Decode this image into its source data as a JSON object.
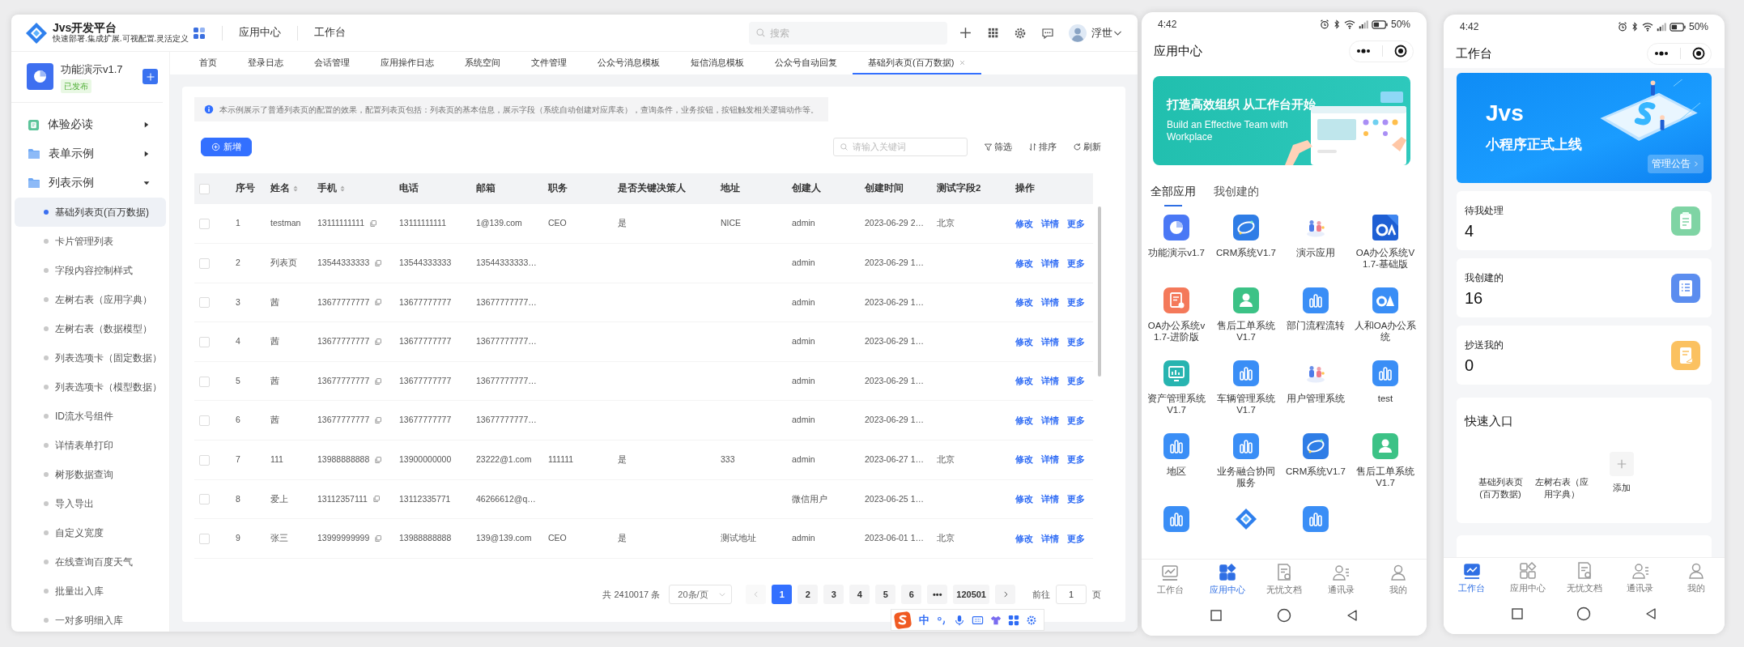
{
  "desktop": {
    "brand": {
      "name": "Jvs开发平台",
      "tagline": "快速部署.集成扩展.可视配置.灵活定义"
    },
    "top_nav": [
      {
        "label": "应用中心"
      },
      {
        "label": "工作台"
      }
    ],
    "search": {
      "placeholder": "搜索"
    },
    "user": {
      "name": "浮世"
    },
    "app": {
      "name": "功能演示v1.7",
      "status": "已发布"
    },
    "menu": [
      {
        "label": "体验必读",
        "kind": "guide",
        "expanded": false
      },
      {
        "label": "表单示例",
        "kind": "folder",
        "expanded": false
      },
      {
        "label": "列表示例",
        "kind": "folder",
        "expanded": true,
        "children": [
          {
            "label": "基础列表页(百万数据)",
            "selected": true
          },
          {
            "label": "卡片管理列表",
            "selected": false
          },
          {
            "label": "字段内容控制样式",
            "selected": false
          },
          {
            "label": "左树右表（应用字典）",
            "selected": false
          },
          {
            "label": "左树右表（数据模型）",
            "selected": false
          },
          {
            "label": "列表选项卡（固定数据）",
            "selected": false
          },
          {
            "label": "列表选项卡（模型数据）",
            "selected": false
          },
          {
            "label": "ID流水号组件",
            "selected": false
          },
          {
            "label": "详情表单打印",
            "selected": false
          },
          {
            "label": "树形数据查询",
            "selected": false
          },
          {
            "label": "导入导出",
            "selected": false
          },
          {
            "label": "自定义宽度",
            "selected": false
          },
          {
            "label": "在线查询百度天气",
            "selected": false
          },
          {
            "label": "批量出入库",
            "selected": false
          },
          {
            "label": "一对多明细入库",
            "selected": false
          }
        ]
      }
    ],
    "tabs": [
      {
        "label": "首页",
        "selected": false
      },
      {
        "label": "登录日志",
        "selected": false
      },
      {
        "label": "会话管理",
        "selected": false
      },
      {
        "label": "应用操作日志",
        "selected": false
      },
      {
        "label": "系统空间",
        "selected": false
      },
      {
        "label": "文件管理",
        "selected": false
      },
      {
        "label": "公众号消息模板",
        "selected": false
      },
      {
        "label": "短信消息模板",
        "selected": false
      },
      {
        "label": "公众号自动回复",
        "selected": false
      },
      {
        "label": "基础列表页(百万数据)",
        "selected": true
      }
    ],
    "notice": "本示例展示了普通列表页的配置的效果，配置列表页包括：列表页的基本信息，展示字段（系统自动创建对应库表），查询条件，业务按钮，按钮触发相关逻辑动作等。",
    "add_button": "新增",
    "keyword_search": {
      "placeholder": "请输入关键词"
    },
    "tools": [
      {
        "label": "筛选",
        "kind": "filter"
      },
      {
        "label": "排序",
        "kind": "sort"
      },
      {
        "label": "刷新",
        "kind": "refresh"
      }
    ],
    "table": {
      "all_checked": false,
      "columns": [
        {
          "label": "序号",
          "sortable": false
        },
        {
          "label": "姓名",
          "sortable": true
        },
        {
          "label": "手机",
          "sortable": true,
          "copyable": true
        },
        {
          "label": "电话",
          "sortable": false
        },
        {
          "label": "邮箱",
          "sortable": false
        },
        {
          "label": "职务",
          "sortable": false
        },
        {
          "label": "是否关键决策人",
          "sortable": false
        },
        {
          "label": "地址",
          "sortable": false
        },
        {
          "label": "创建人",
          "sortable": false
        },
        {
          "label": "创建时间",
          "sortable": false
        },
        {
          "label": "测试字段2",
          "sortable": false
        },
        {
          "label": "操作",
          "sortable": false
        }
      ],
      "rows": [
        {
          "checked": false,
          "cells": [
            "1",
            "testman",
            "13111111111",
            "13111111111",
            "1@139.com",
            "CEO",
            "是",
            "NICE",
            "admin",
            "2023-06-29 2…",
            "北京"
          ],
          "actions": [
            "修改",
            "详情",
            "更多"
          ]
        },
        {
          "checked": false,
          "cells": [
            "2",
            "列表页",
            "13544333333",
            "13544333333",
            "13544333333…",
            null,
            null,
            null,
            "admin",
            "2023-06-29 1…",
            null
          ],
          "actions": [
            "修改",
            "详情",
            "更多"
          ]
        },
        {
          "checked": false,
          "cells": [
            "3",
            "茜",
            "13677777777",
            "13677777777",
            "13677777777…",
            null,
            null,
            null,
            "admin",
            "2023-06-29 1…",
            null
          ],
          "actions": [
            "修改",
            "详情",
            "更多"
          ]
        },
        {
          "checked": false,
          "cells": [
            "4",
            "茜",
            "13677777777",
            "13677777777",
            "13677777777…",
            null,
            null,
            null,
            "admin",
            "2023-06-29 1…",
            null
          ],
          "actions": [
            "修改",
            "详情",
            "更多"
          ]
        },
        {
          "checked": false,
          "cells": [
            "5",
            "茜",
            "13677777777",
            "13677777777",
            "13677777777…",
            null,
            null,
            null,
            "admin",
            "2023-06-29 1…",
            null
          ],
          "actions": [
            "修改",
            "详情",
            "更多"
          ]
        },
        {
          "checked": false,
          "cells": [
            "6",
            "茜",
            "13677777777",
            "13677777777",
            "13677777777…",
            null,
            null,
            null,
            "admin",
            "2023-06-29 1…",
            null
          ],
          "actions": [
            "修改",
            "详情",
            "更多"
          ]
        },
        {
          "checked": false,
          "cells": [
            "7",
            "111",
            "13988888888",
            "13900000000",
            "23222@1.com",
            "111111",
            "是",
            "333",
            "admin",
            "2023-06-27 1…",
            "北京"
          ],
          "actions": [
            "修改",
            "详情",
            "更多"
          ]
        },
        {
          "checked": false,
          "cells": [
            "8",
            "爱上",
            "13112357111",
            "13112335771",
            "46266612@q…",
            null,
            null,
            null,
            "微信用户",
            "2023-06-25 1…",
            null
          ],
          "actions": [
            "修改",
            "详情",
            "更多"
          ]
        },
        {
          "checked": false,
          "cells": [
            "9",
            "张三",
            "13999999999",
            "13988888888",
            "139@139.com",
            "CEO",
            "是",
            "测试地址",
            "admin",
            "2023-06-01 1…",
            "北京"
          ],
          "actions": [
            "修改",
            "详情",
            "更多"
          ]
        }
      ]
    },
    "pagination": {
      "total": "共 2410017 条",
      "page_size": "20条/页",
      "prev_disabled": true,
      "pages": [
        {
          "label": "1",
          "selected": true
        },
        {
          "label": "2",
          "selected": false
        },
        {
          "label": "3",
          "selected": false
        },
        {
          "label": "4",
          "selected": false
        },
        {
          "label": "5",
          "selected": false
        },
        {
          "label": "6",
          "selected": false
        },
        {
          "label": "•••",
          "selected": false
        },
        {
          "label": "120501",
          "selected": false
        }
      ],
      "goto": {
        "label": "前往",
        "value": "1",
        "suffix": "页"
      }
    }
  },
  "ime_bar": {
    "mode": "中"
  },
  "phone_apps": {
    "status": {
      "time": "4:42",
      "battery": "50%"
    },
    "title": "应用中心",
    "banner": {
      "headline": "打造高效组织 从工作台开始",
      "subline": "Build an Effective Team with Workplace"
    },
    "tabs": [
      {
        "label": "全部应用",
        "selected": true
      },
      {
        "label": "我创建的",
        "selected": false
      }
    ],
    "apps": [
      {
        "name": "功能演示v1.7",
        "kind": "pie"
      },
      {
        "name": "CRM系统V1.7",
        "kind": "crm"
      },
      {
        "name": "演示应用",
        "kind": "figures"
      },
      {
        "name": "OA办公系统V1.7-基础版",
        "kind": "oa"
      },
      {
        "name": "OA办公系统v1.7-进阶版",
        "kind": "doc"
      },
      {
        "name": "售后工单系统V1.7",
        "kind": "person"
      },
      {
        "name": "部门流程流转",
        "kind": "bars"
      },
      {
        "name": "人和OA办公系统",
        "kind": "oa2"
      },
      {
        "name": "资产管理系统V1.7",
        "kind": "monitor"
      },
      {
        "name": "车辆管理系统V1.7",
        "kind": "bars"
      },
      {
        "name": "用户管理系统",
        "kind": "figures"
      },
      {
        "name": "test",
        "kind": "bars"
      },
      {
        "name": "地区",
        "kind": "bars"
      },
      {
        "name": "业务融合协同服务",
        "kind": "bars"
      },
      {
        "name": "CRM系统V1.7",
        "kind": "crm"
      },
      {
        "name": "售后工单系统V1.7",
        "kind": "person"
      },
      {
        "kind": "bars"
      },
      {
        "kind": "logo"
      },
      {
        "kind": "bars"
      }
    ],
    "nav": [
      {
        "label": "工作台",
        "kind": "chart",
        "selected": false
      },
      {
        "label": "应用中心",
        "kind": "apps",
        "selected": true
      },
      {
        "label": "无忧文档",
        "kind": "docs",
        "selected": false
      },
      {
        "label": "通讯录",
        "kind": "contacts",
        "selected": false
      },
      {
        "label": "我的",
        "kind": "me",
        "selected": false
      }
    ]
  },
  "phone_workbench": {
    "status": {
      "time": "4:42",
      "battery": "50%"
    },
    "title": "工作台",
    "banner": {
      "brand": "Jvs",
      "headline": "小程序正式上线",
      "button": "管理公告"
    },
    "stats": [
      {
        "label": "待我处理",
        "count": "4",
        "kind": "todo"
      },
      {
        "label": "我创建的",
        "count": "16",
        "kind": "created"
      },
      {
        "label": "抄送我的",
        "count": "0",
        "kind": "cc"
      }
    ],
    "quick": {
      "title": "快速入口",
      "items": [
        {
          "label": "基础列表页(百万数据)"
        },
        {
          "label": "左树右表（应用字典）"
        }
      ],
      "add_label": "添加"
    },
    "nav": [
      {
        "label": "工作台",
        "kind": "chart",
        "selected": true
      },
      {
        "label": "应用中心",
        "kind": "apps",
        "selected": false
      },
      {
        "label": "无忧文档",
        "kind": "docs",
        "selected": false
      },
      {
        "label": "通讯录",
        "kind": "contacts",
        "selected": false
      },
      {
        "label": "我的",
        "kind": "me",
        "selected": false
      }
    ]
  }
}
